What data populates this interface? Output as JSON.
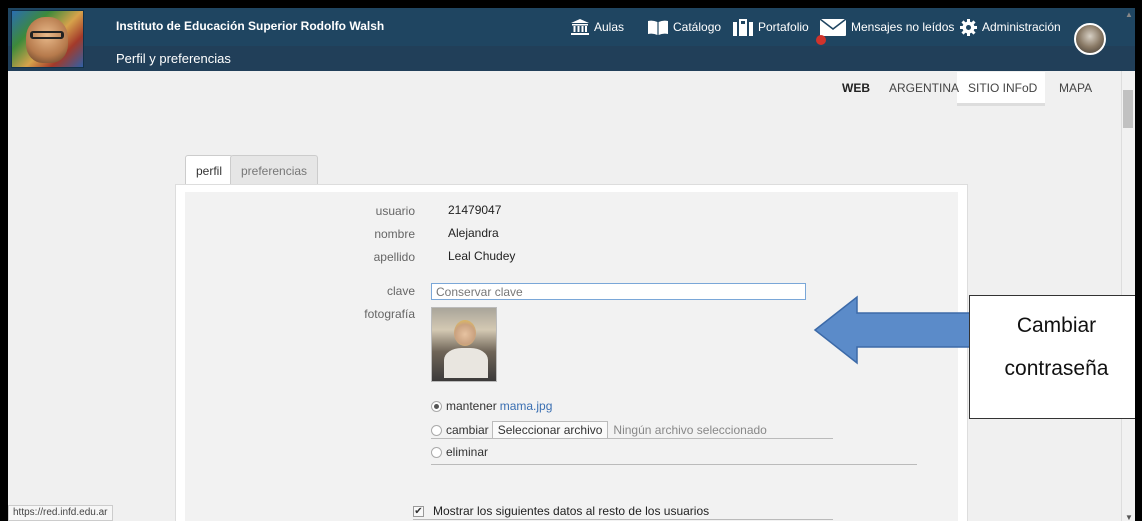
{
  "header": {
    "institution": "Instituto de Educación Superior Rodolfo Walsh",
    "subtitle": "Perfil y preferencias",
    "nav": [
      {
        "label": "Aulas",
        "icon": "building-columns-icon"
      },
      {
        "label": "Catálogo",
        "icon": "book-open-icon"
      },
      {
        "label": "Portafolio",
        "icon": "portfolio-icon"
      },
      {
        "label": "Mensajes no leídos",
        "icon": "envelope-icon"
      },
      {
        "label": "Administración",
        "icon": "gear-icon"
      }
    ]
  },
  "subnav": {
    "items": [
      "WEB",
      "ARGENTINA",
      "SITIO INFoD",
      "MAPA"
    ],
    "active": "SITIO INFoD"
  },
  "tabs": [
    {
      "label": "perfil",
      "active": true
    },
    {
      "label": "preferencias",
      "active": false
    }
  ],
  "profile": {
    "usuario_label": "usuario",
    "usuario_value": "21479047",
    "nombre_label": "nombre",
    "nombre_value": "Alejandra",
    "apellido_label": "apellido",
    "apellido_value": "Leal Chudey",
    "clave_label": "clave",
    "clave_placeholder": "Conservar clave",
    "foto_label": "fotografía"
  },
  "photo_options": {
    "keep_label": "mantener",
    "keep_file": "mama.jpg",
    "change_label": "cambiar",
    "file_button": "Seleccionar archivo",
    "file_none": "Ningún archivo seleccionado",
    "delete_label": "eliminar",
    "selected": "mantener"
  },
  "show_data_label": "Mostrar los siguientes datos al resto de los usuarios",
  "status_url": "https://red.infd.edu.ar",
  "callout": {
    "line1": "Cambiar",
    "line2": "contraseña"
  },
  "colors": {
    "header_bg": "#1f4561",
    "accent_link": "#3a6fb2",
    "callout_arrow": "#5b8bc9"
  }
}
